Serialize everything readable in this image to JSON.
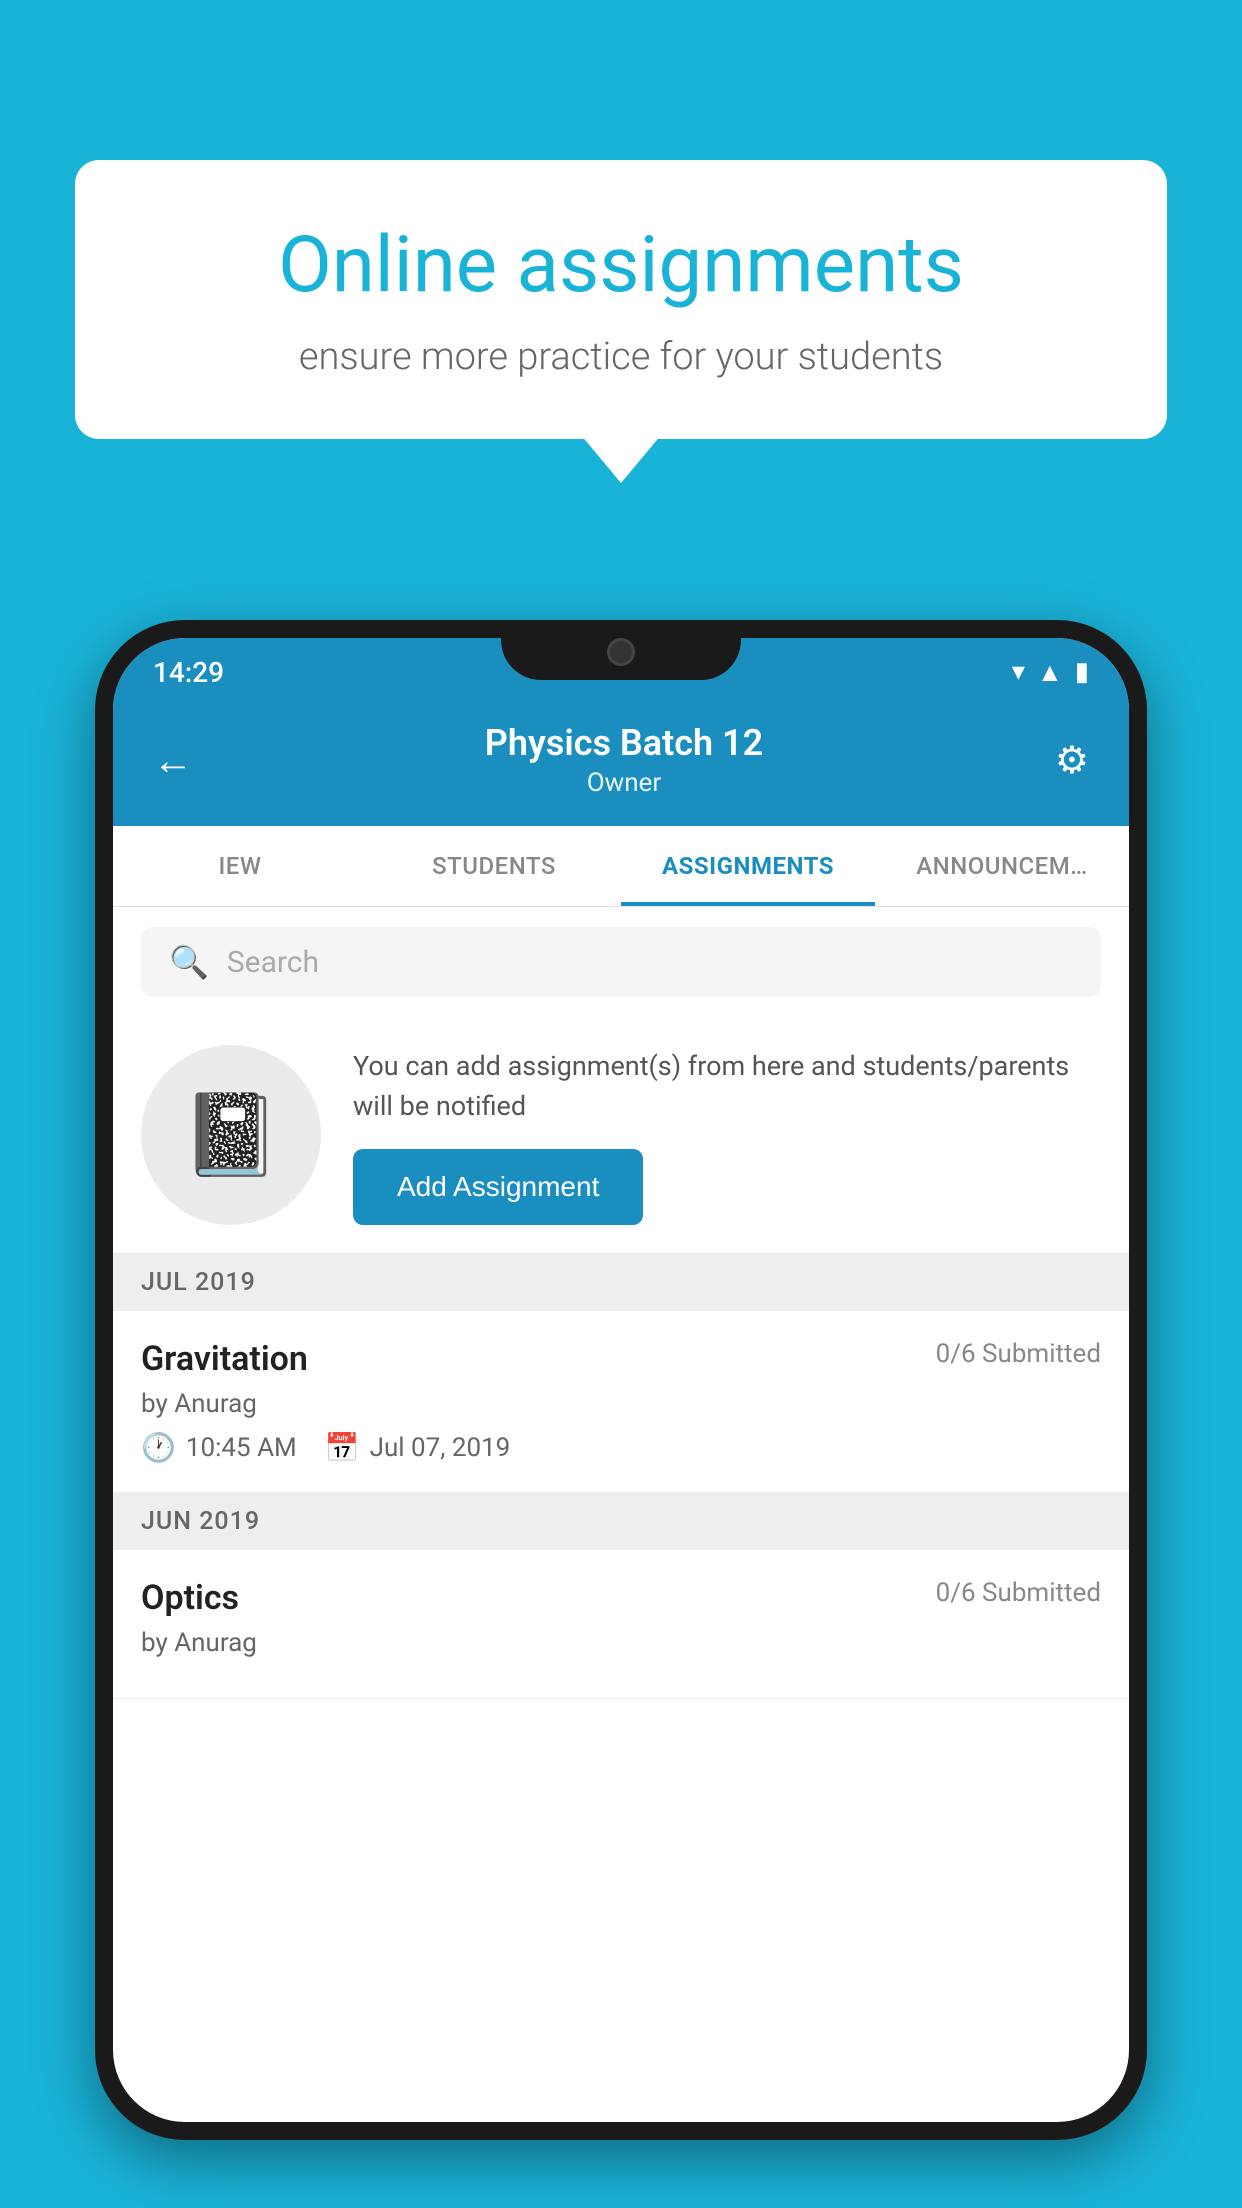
{
  "background_color": "#1ab3d8",
  "speech_bubble": {
    "title": "Online assignments",
    "subtitle": "ensure more practice for your students"
  },
  "phone": {
    "status_bar": {
      "time": "14:29",
      "icons": [
        "wifi",
        "signal",
        "battery"
      ]
    },
    "header": {
      "title": "Physics Batch 12",
      "subtitle": "Owner",
      "back_label": "←",
      "settings_label": "⚙"
    },
    "tabs": [
      {
        "label": "IEW",
        "active": false
      },
      {
        "label": "STUDENTS",
        "active": false
      },
      {
        "label": "ASSIGNMENTS",
        "active": true
      },
      {
        "label": "ANNOUNCEM…",
        "active": false
      }
    ],
    "search": {
      "placeholder": "Search"
    },
    "promo": {
      "text": "You can add assignment(s) from here and students/parents will be notified",
      "button_label": "Add Assignment"
    },
    "sections": [
      {
        "month_label": "JUL 2019",
        "assignments": [
          {
            "name": "Gravitation",
            "submitted": "0/6 Submitted",
            "by": "by Anurag",
            "time": "10:45 AM",
            "date": "Jul 07, 2019"
          }
        ]
      },
      {
        "month_label": "JUN 2019",
        "assignments": [
          {
            "name": "Optics",
            "submitted": "0/6 Submitted",
            "by": "by Anurag",
            "time": "",
            "date": ""
          }
        ]
      }
    ]
  }
}
